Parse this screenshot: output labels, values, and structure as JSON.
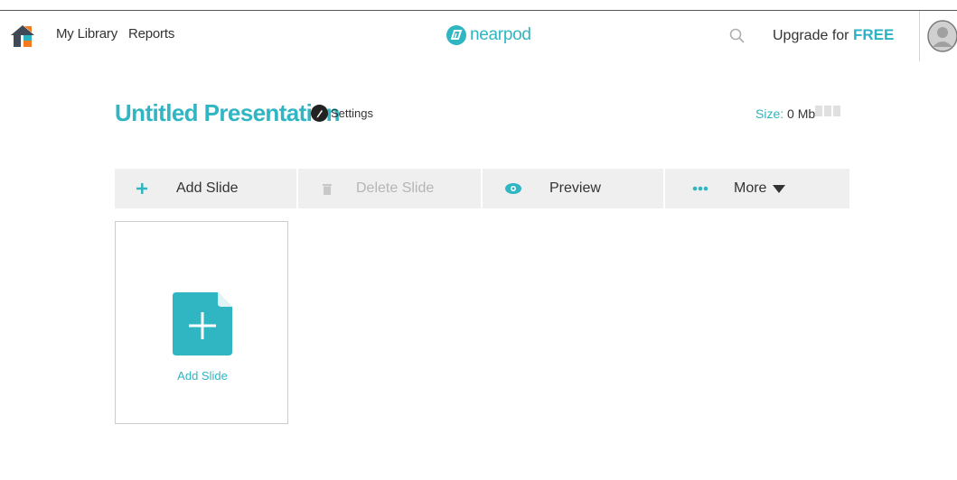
{
  "nav": {
    "my_library": "My Library",
    "reports": "Reports",
    "logo_text": "nearpod",
    "upgrade_prefix": "Upgrade for",
    "upgrade_highlight": "FREE"
  },
  "presentation": {
    "title": "Untitled Presentation",
    "settings_label": "Settings",
    "size_label": "Size:",
    "size_value": "0 Mb"
  },
  "toolbar": {
    "add_slide": "Add Slide",
    "delete_slide": "Delete Slide",
    "preview": "Preview",
    "more": "More"
  },
  "card": {
    "add_slide_label": "Add Slide"
  },
  "colors": {
    "accent": "#30b5c2",
    "toolbar_bg": "#efefef",
    "disabled_text": "#b5b5b5"
  },
  "icons": [
    "home-icon",
    "nearpod-logo-icon",
    "search-icon",
    "avatar-icon",
    "pencil-icon",
    "plus-icon",
    "trash-icon",
    "eye-icon",
    "dots-icon",
    "caret-down-icon",
    "add-slide-icon"
  ]
}
